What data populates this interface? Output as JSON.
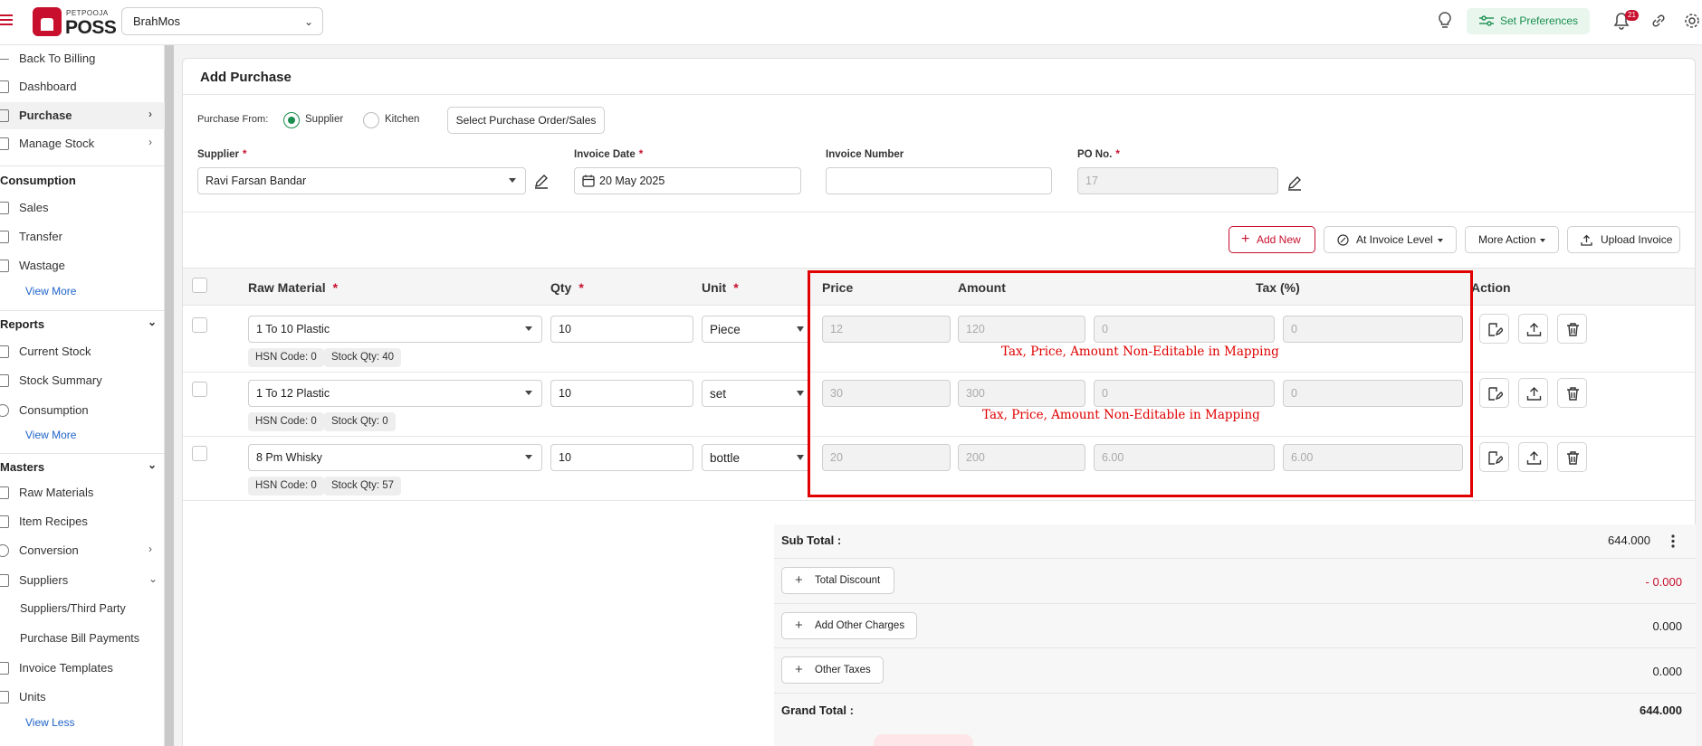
{
  "header": {
    "brand_small": "PETPOOJA",
    "brand_big": "POSS",
    "outlet": "BrahMos",
    "preferences_label": "Set Preferences",
    "notification_count": "21"
  },
  "sidebar": {
    "items": [
      {
        "label": "Back To Billing"
      },
      {
        "label": "Dashboard"
      },
      {
        "label": "Purchase"
      },
      {
        "label": "Manage Stock"
      },
      {
        "label": "Sales"
      },
      {
        "label": "Transfer"
      },
      {
        "label": "Wastage"
      },
      {
        "label": "Current Stock"
      },
      {
        "label": "Stock Summary"
      },
      {
        "label": "Consumption"
      },
      {
        "label": "Raw Materials"
      },
      {
        "label": "Item Recipes"
      },
      {
        "label": "Conversion"
      },
      {
        "label": "Suppliers"
      },
      {
        "label": "Invoice Templates"
      },
      {
        "label": "Units"
      }
    ],
    "sections": {
      "consumption": "Consumption",
      "reports": "Reports",
      "masters": "Masters"
    },
    "view_more_1": "View More",
    "view_more_2": "View More",
    "view_less": "View Less",
    "sub_items": [
      "Suppliers/Third Party",
      "Purchase Bill Payments"
    ]
  },
  "page": {
    "title": "Add Purchase",
    "purchase_from_label": "Purchase From:",
    "radio_supplier": "Supplier",
    "radio_kitchen": "Kitchen",
    "select_po_button": "Select Purchase Order/Sales",
    "fields": {
      "supplier_label": "Supplier",
      "supplier_value": "Ravi Farsan Bandar",
      "invoice_date_label": "Invoice Date",
      "invoice_date_value": "20 May 2025",
      "invoice_number_label": "Invoice Number",
      "invoice_number_value": "",
      "po_label": "PO No.",
      "po_value": "17",
      "required_mark": "*"
    },
    "toolbar": {
      "add_new": "Add New",
      "invoice_level": "At Invoice Level",
      "more_action": "More Action",
      "upload_invoice": "Upload Invoice"
    }
  },
  "table": {
    "headers": {
      "raw_material": "Raw Material",
      "qty": "Qty",
      "unit": "Unit",
      "price": "Price",
      "amount": "Amount",
      "tax": "Tax (%)",
      "action": "Action"
    },
    "rows": [
      {
        "material": "1 To 10 Plastic",
        "hsn": "HSN Code: 0",
        "stock": "Stock Qty: 40",
        "qty": "10",
        "unit": "Piece",
        "price": "12",
        "amount": "120",
        "tax_amt": "0",
        "tax_pct": "0"
      },
      {
        "material": "1 To 12 Plastic",
        "hsn": "HSN Code: 0",
        "stock": "Stock Qty: 0",
        "qty": "10",
        "unit": "set",
        "price": "30",
        "amount": "300",
        "tax_amt": "0",
        "tax_pct": "0"
      },
      {
        "material": "8 Pm Whisky",
        "hsn": "HSN Code: 0",
        "stock": "Stock Qty: 57",
        "qty": "10",
        "unit": "bottle",
        "price": "20",
        "amount": "200",
        "tax_amt": "6.00",
        "tax_pct": "6.00"
      }
    ],
    "annotation": "Tax, Price, Amount Non-Editable in Mapping"
  },
  "summary": {
    "sub_total_label": "Sub Total :",
    "sub_total_value": "644.000",
    "discount_label": "Total Discount",
    "discount_value": "- 0.000",
    "other_charges_label": "Add Other Charges",
    "other_charges_value": "0.000",
    "other_taxes_label": "Other Taxes",
    "other_taxes_value": "0.000",
    "grand_total_label": "Grand Total :",
    "grand_total_value": "644.000"
  },
  "colors": {
    "brand": "#c8102e",
    "accent_green": "#1a8f4f",
    "annotation_red": "#e00000"
  }
}
